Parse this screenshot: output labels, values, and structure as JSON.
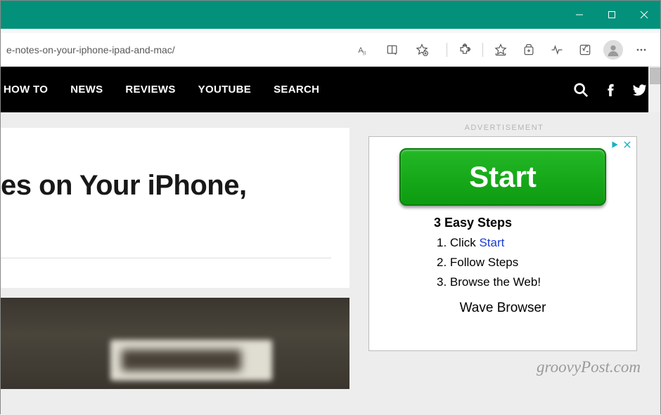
{
  "url": "e-notes-on-your-iphone-ipad-and-mac/",
  "nav": {
    "items": [
      "HOW TO",
      "NEWS",
      "REVIEWS",
      "YOUTUBE",
      "SEARCH"
    ]
  },
  "article": {
    "title_fragment": "es on Your iPhone,"
  },
  "sidebar": {
    "ad_label": "ADVERTISEMENT",
    "ad": {
      "start_button": "Start",
      "steps_title": "3 Easy Steps",
      "step1_prefix": "Click ",
      "step1_link": "Start",
      "step2": "Follow Steps",
      "step3": "Browse the Web!",
      "brand": "Wave Browser"
    },
    "watermark": "groovyPost.com"
  }
}
